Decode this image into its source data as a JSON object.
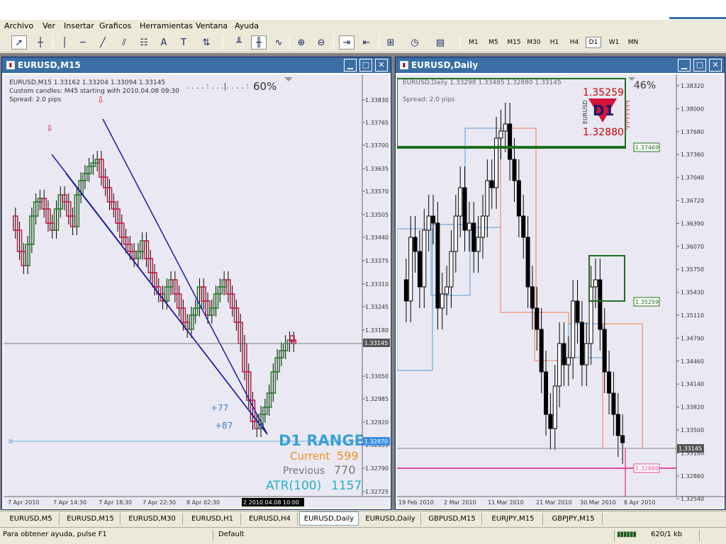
{
  "menu": [
    "Archivo",
    "Ver",
    "Insertar",
    "Graficos",
    "Herramientas",
    "Ventana",
    "Ayuda"
  ],
  "timeframes": [
    "M1",
    "M5",
    "M15",
    "M30",
    "H1",
    "H4",
    "D1",
    "W1",
    "MN"
  ],
  "active_timeframe": "D1",
  "left_window": {
    "title": "EURUSD,M15",
    "info_line1": "EURUSD,M15  1.33162 1.33204 1.33094 1.33145",
    "info_line2": "Custom candles: M45 starting with 2010.04.08 09:30",
    "info_line3": "Spread: 2.0 pips",
    "percent": "60%",
    "price_ticks": [
      "1.33830",
      "1.33765",
      "1.33700",
      "1.33635",
      "1.33570",
      "1.33505",
      "1.33440",
      "1.33375",
      "1.33310",
      "1.33245",
      "1.33180",
      "1.33050",
      "1.32985",
      "1.32920",
      "1.32855",
      "1.32790",
      "1.32725"
    ],
    "current_price": "1.33145",
    "low_price_label": "1.32870",
    "time_ticks": [
      "7 Apr 2010",
      "7 Apr 14:30",
      "7 Apr 18:30",
      "7 Apr 22:30",
      "8 Apr 02:30",
      "8 Apr 06:30"
    ],
    "cursor_time": "2 2010.04.08 10:00",
    "ann_plus77": "+77",
    "ann_plus87": "+87",
    "range_title": "D1 RANGE",
    "current_label": "Current",
    "current_value": "599",
    "previous_label": "Previous",
    "previous_value": "770",
    "atr_label": "ATR(100)",
    "atr_value": "1157"
  },
  "right_window": {
    "title": "EURUSD,Daily",
    "info_line1": "EURUSD,Daily  1.33298 1.33485 1.32880 1.33145",
    "info_line2": "Spread: 2.0 pips",
    "percent": "46%",
    "panel_high": "1.35259",
    "panel_symbol": "EURUSD",
    "panel_tf": "D1",
    "panel_low": "1.32880",
    "price_ticks": [
      "1.38320",
      "1.38000",
      "1.37680",
      "1.37360",
      "1.37040",
      "1.36720",
      "1.36390",
      "1.36070",
      "1.35750",
      "1.35430",
      "1.35110",
      "1.34790",
      "1.34460",
      "1.34140",
      "1.33820",
      "1.33500",
      "1.33180",
      "1.32860",
      "1.32540"
    ],
    "level1": "1.37469",
    "level2": "1.35259",
    "current_price": "1.33145",
    "pink_level": "1.32880",
    "time_ticks": [
      "19 Feb 2010",
      "2 Mar 2010",
      "11 Mar 2010",
      "21 Mar 2010",
      "30 Mar 2010",
      "8 Apr 2010"
    ]
  },
  "tabs": [
    "EURUSD,M5",
    "EURUSD,M15",
    "EURUSD,M30",
    "EURUSD,H1",
    "EURUSD,H4",
    "EURUSD,Daily",
    "EURUSD,Daily",
    "GBPUSD,M15",
    "EURJPY,M15",
    "GBPJPY,M15"
  ],
  "active_tab_index": 5,
  "status": {
    "help": "Para obtener ayuda, pulse F1",
    "profile": "Default",
    "traffic": "620/1 kb"
  }
}
